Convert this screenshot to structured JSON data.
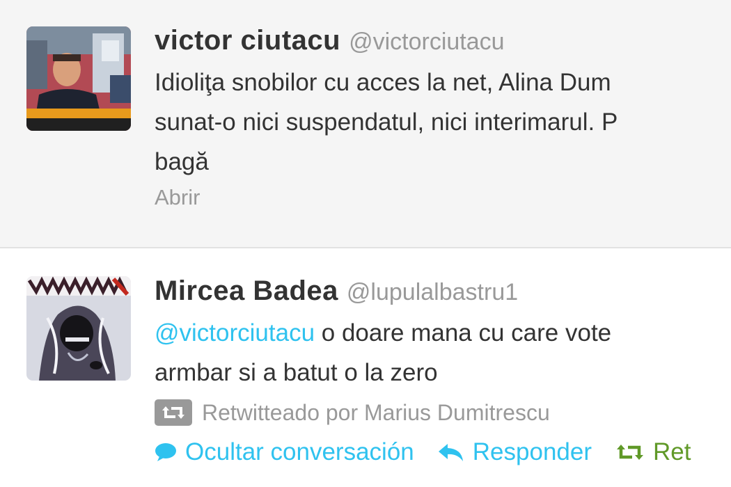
{
  "tweets": [
    {
      "fullname": "victor ciutacu",
      "username": "@victorciutacu",
      "text_lines": [
        "Idioliţa snobilor cu acces la net, Alina Dum",
        "sunat-o nici suspendatul, nici interimarul. P",
        "bagă"
      ],
      "open_label": "Abrir",
      "avatar_icon": "tv-studio-photo"
    },
    {
      "fullname": "Mircea Badea",
      "username": "@lupulalbastru1",
      "mention": "@victorciutacu",
      "text_line_1_rest": " o doare mana cu care vote",
      "text_line_2": "armbar si a batut o la zero",
      "retweeted_by": "Retwitteado por Marius Dumitrescu",
      "avatar_icon": "dark-artwork",
      "actions": {
        "hide_conversation": "Ocultar conversación",
        "reply": "Responder",
        "retweet": "Ret"
      }
    }
  ],
  "colors": {
    "link": "#2fc2ef",
    "retweet_green": "#609928",
    "muted": "#999999",
    "text": "#333333"
  }
}
